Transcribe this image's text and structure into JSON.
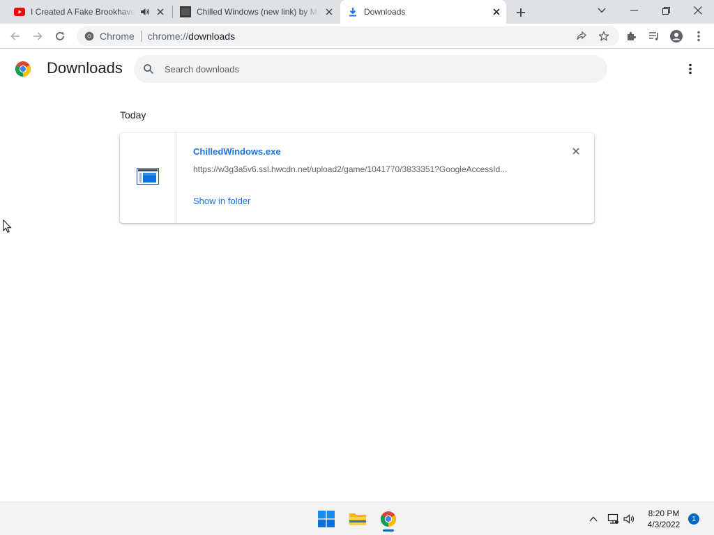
{
  "tabs": [
    {
      "title": "I Created A Fake Brookhaven Rap...",
      "favicon": "youtube-icon",
      "audio": "speaker-icon"
    },
    {
      "title": "Chilled Windows (new link) by Maxi...",
      "favicon": "game-thumbnail-icon"
    },
    {
      "title": "Downloads",
      "favicon": "download-icon",
      "active": true
    }
  ],
  "toolbar": {
    "site_label": "Chrome",
    "url_scheme": "chrome://",
    "url_host": "downloads"
  },
  "page": {
    "title": "Downloads",
    "search_placeholder": "Search downloads"
  },
  "downloads": {
    "section_date": "Today",
    "items": [
      {
        "file_name": "ChilledWindows.exe",
        "url": "https://w3g3a5v6.ssl.hwcdn.net/upload2/game/1041770/3833351?GoogleAccessId...",
        "action": "Show in folder"
      }
    ]
  },
  "taskbar": {
    "time": "8:20 PM",
    "date": "4/3/2022",
    "notifications": "1"
  },
  "colors": {
    "accent": "#1a73e8",
    "tabstrip": "#dee1e6",
    "taskbar_accent": "#0067c0"
  }
}
